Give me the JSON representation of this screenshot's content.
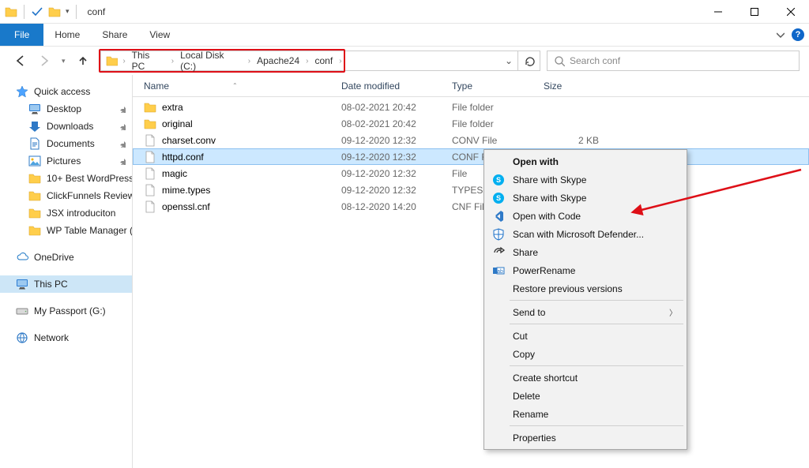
{
  "window": {
    "title": "conf"
  },
  "ribbon": {
    "file": "File",
    "tabs": [
      "Home",
      "Share",
      "View"
    ]
  },
  "breadcrumb": [
    "This PC",
    "Local Disk (C:)",
    "Apache24",
    "conf"
  ],
  "search": {
    "placeholder": "Search conf"
  },
  "sidebar": {
    "quick_access": "Quick access",
    "quick_items": [
      {
        "label": "Desktop",
        "pinned": true
      },
      {
        "label": "Downloads",
        "pinned": true
      },
      {
        "label": "Documents",
        "pinned": true
      },
      {
        "label": "Pictures",
        "pinned": true
      },
      {
        "label": "10+ Best WordPress",
        "pinned": true
      },
      {
        "label": "ClickFunnels Review",
        "pinned": true
      },
      {
        "label": "JSX introduciton",
        "pinned": true
      },
      {
        "label": "WP Table Manager (",
        "pinned": true
      }
    ],
    "onedrive": "OneDrive",
    "this_pc": "This PC",
    "passport": "My Passport (G:)",
    "network": "Network"
  },
  "columns": {
    "name": "Name",
    "date": "Date modified",
    "type": "Type",
    "size": "Size"
  },
  "files": [
    {
      "icon": "folder",
      "name": "extra",
      "date": "08-02-2021 20:42",
      "type": "File folder",
      "size": ""
    },
    {
      "icon": "folder",
      "name": "original",
      "date": "08-02-2021 20:42",
      "type": "File folder",
      "size": ""
    },
    {
      "icon": "file",
      "name": "charset.conv",
      "date": "09-12-2020 12:32",
      "type": "CONV File",
      "size": "2 KB"
    },
    {
      "icon": "file",
      "name": "httpd.conf",
      "date": "09-12-2020 12:32",
      "type": "CONF File",
      "size": "",
      "selected": true
    },
    {
      "icon": "file",
      "name": "magic",
      "date": "09-12-2020 12:32",
      "type": "File",
      "size": ""
    },
    {
      "icon": "file",
      "name": "mime.types",
      "date": "09-12-2020 12:32",
      "type": "TYPES File",
      "size": ""
    },
    {
      "icon": "file",
      "name": "openssl.cnf",
      "date": "08-12-2020 14:20",
      "type": "CNF File",
      "size": ""
    }
  ],
  "context_menu": {
    "open_with": "Open with",
    "skype1": "Share with Skype",
    "skype2": "Share with Skype",
    "open_code": "Open with Code",
    "defender": "Scan with Microsoft Defender...",
    "share": "Share",
    "powerrename": "PowerRename",
    "restore": "Restore previous versions",
    "send_to": "Send to",
    "cut": "Cut",
    "copy": "Copy",
    "shortcut": "Create shortcut",
    "delete": "Delete",
    "rename": "Rename",
    "properties": "Properties"
  }
}
